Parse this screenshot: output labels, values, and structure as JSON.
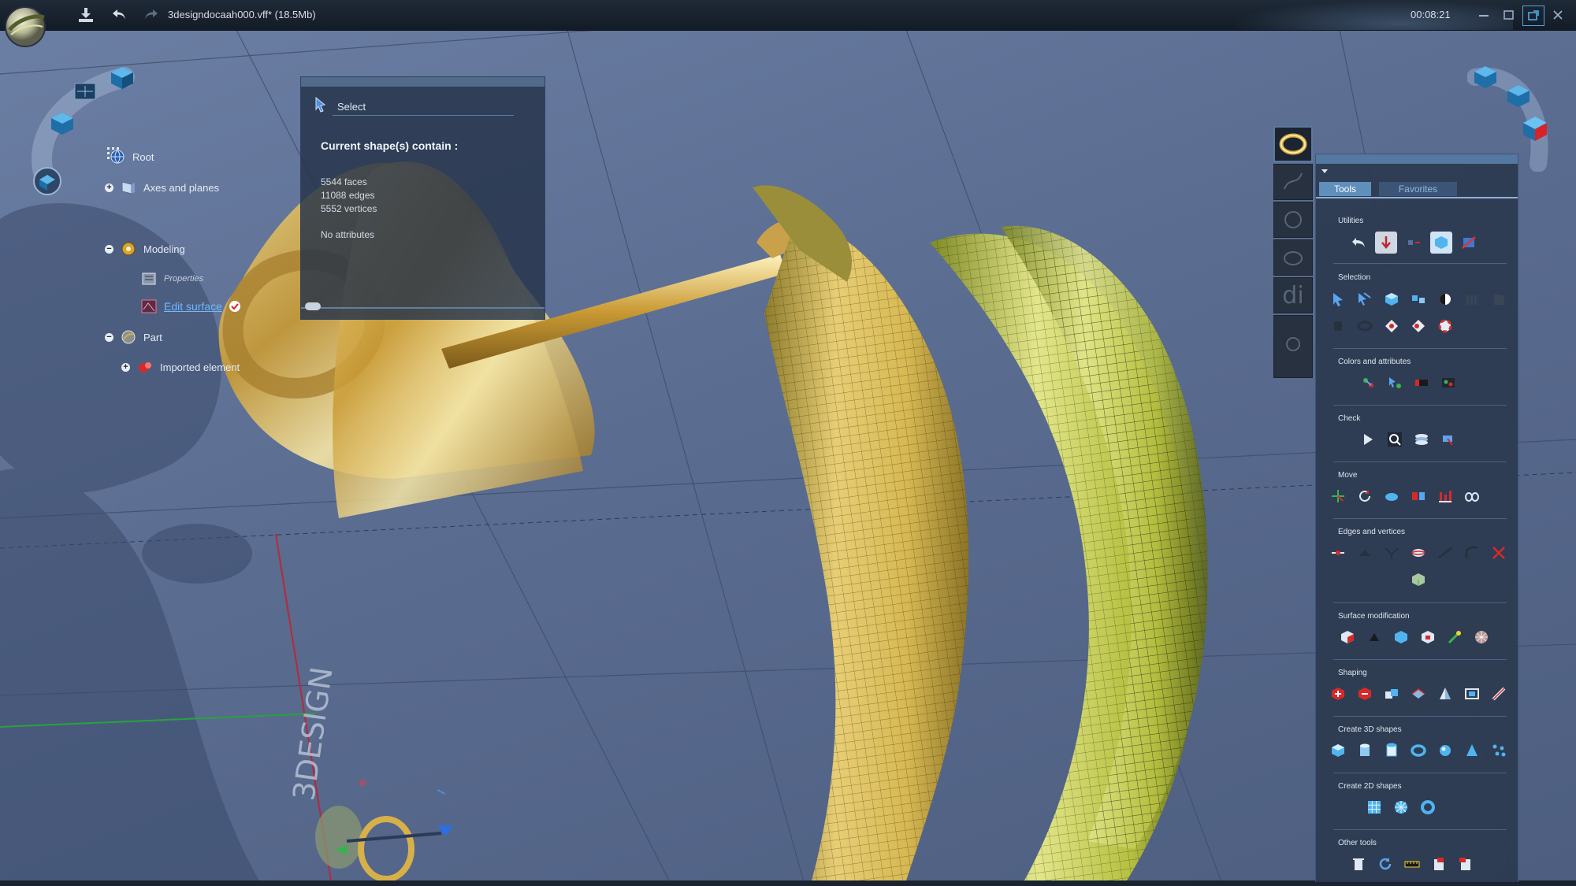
{
  "titlebar": {
    "file_title": "3designdocaah000.vff* (18.5Mb)",
    "timer": "00:08:21",
    "save_icon": "save-download-icon",
    "undo_icon": "undo-icon",
    "redo_icon": "redo-icon"
  },
  "tree": {
    "root": "Root",
    "axes": "Axes and planes",
    "modeling": "Modeling",
    "properties": "Properties",
    "edit_surface": "Edit surface",
    "part": "Part",
    "imported": "Imported element"
  },
  "select_panel": {
    "title": "Select",
    "heading": "Current shape(s) contain :",
    "faces": "5544 faces",
    "edges": "11088 edges",
    "vertices": "5552 vertices",
    "attributes": "No attributes"
  },
  "tools_panel": {
    "tabs": [
      "Tools",
      "Favorites"
    ],
    "active_tab": "Tools",
    "sections": {
      "utilities": "Utilities",
      "selection": "Selection",
      "colors": "Colors and attributes",
      "check": "Check",
      "move": "Move",
      "edges": "Edges and vertices",
      "surface": "Surface modification",
      "shaping": "Shaping",
      "create3d": "Create 3D shapes",
      "create2d": "Create 2D shapes",
      "other": "Other tools"
    }
  },
  "side_buttons": {
    "di_label": "di"
  },
  "watermark": "3DESIGN",
  "colors": {
    "accent": "#5f8fbd",
    "link": "#6fb9ff",
    "gold": "#d9b24a",
    "banana": "#c9d85a"
  }
}
